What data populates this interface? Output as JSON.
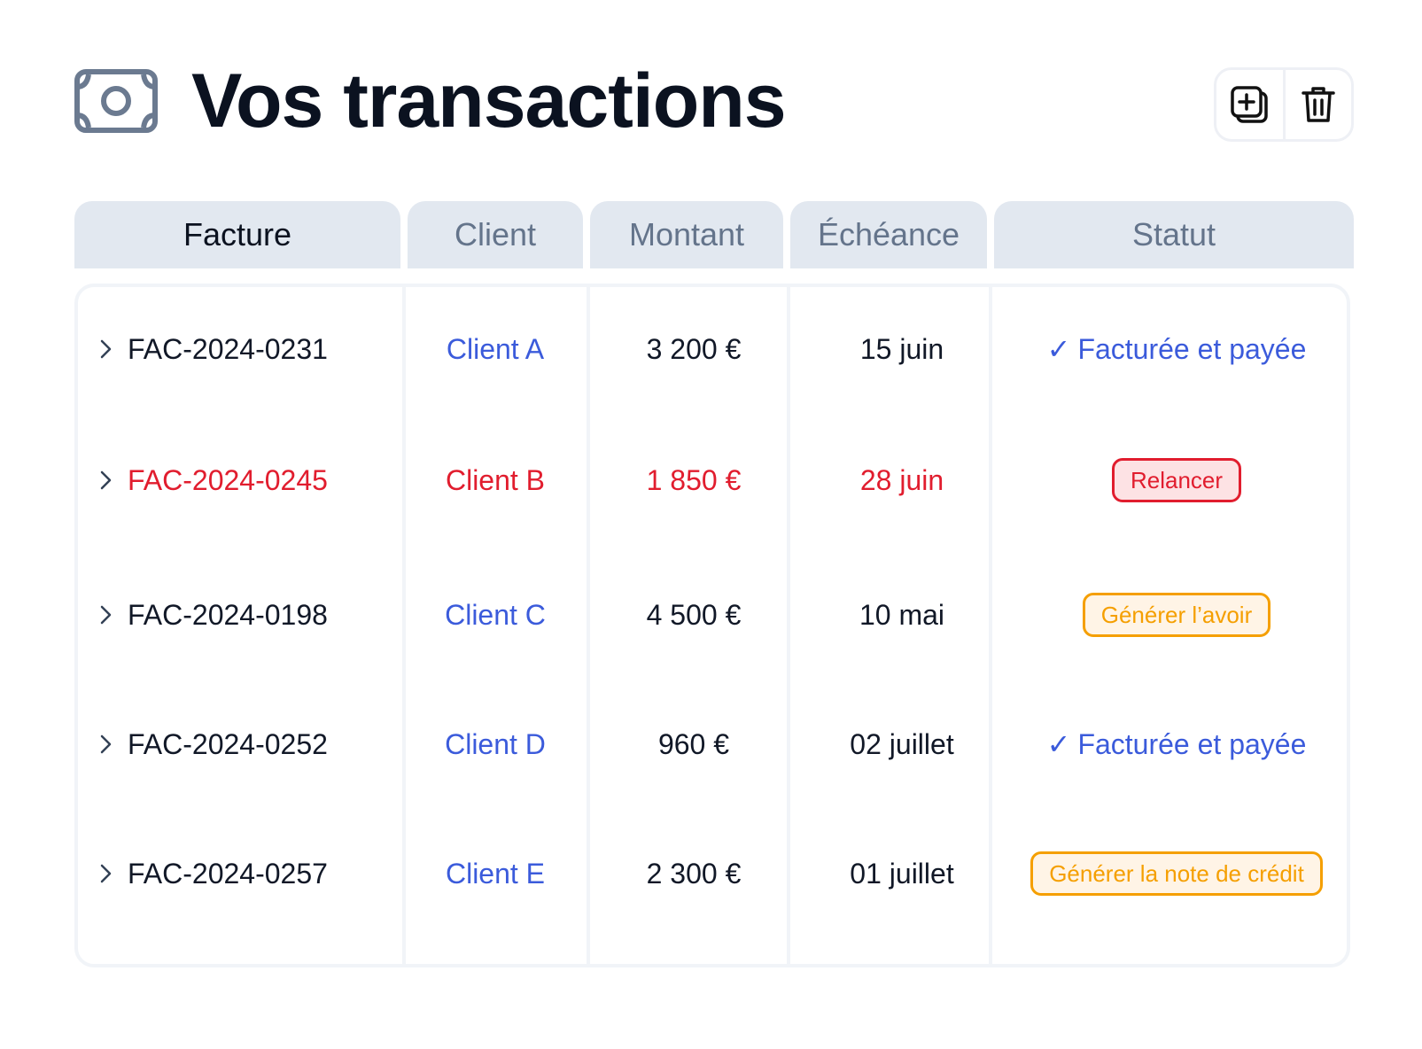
{
  "header": {
    "title": "Vos transactions",
    "icon": "money-bill-icon",
    "actions": [
      {
        "icon": "add-copy-icon"
      },
      {
        "icon": "trash-icon"
      }
    ]
  },
  "table": {
    "columns": [
      "Facture",
      "Client",
      "Montant",
      "Échéance",
      "Statut"
    ],
    "active_column": "Facture",
    "rows": [
      {
        "invoice": "FAC-2024-0231",
        "client": "Client A",
        "amount": "3 200 €",
        "due": "15 juin",
        "status": {
          "type": "paid",
          "check": "✓",
          "label": "Facturée et payée"
        }
      },
      {
        "invoice": "FAC-2024-0245",
        "client": "Client B",
        "amount": "1 850 €",
        "due": "28 juin",
        "overdue": true,
        "status": {
          "type": "action-red",
          "label": "Relancer"
        }
      },
      {
        "invoice": "FAC-2024-0198",
        "client": "Client C",
        "amount": "4 500 €",
        "due": "10 mai",
        "status": {
          "type": "action-orange",
          "label": "Générer l’avoir"
        }
      },
      {
        "invoice": "FAC-2024-0252",
        "client": "Client D",
        "amount": "960 €",
        "due": "02 juillet",
        "status": {
          "type": "paid",
          "check": "✓",
          "label": "Facturée et payée"
        }
      },
      {
        "invoice": "FAC-2024-0257",
        "client": "Client E",
        "amount": "2 300 €",
        "due": "01 juillet",
        "status": {
          "type": "action-orange",
          "label": "Générer la note de crédit"
        }
      }
    ]
  },
  "colors": {
    "accent_blue": "#3b5bdb",
    "danger_red": "#e11d2e",
    "warning_orange": "#f59f00",
    "header_bg": "#e2e8f0"
  }
}
